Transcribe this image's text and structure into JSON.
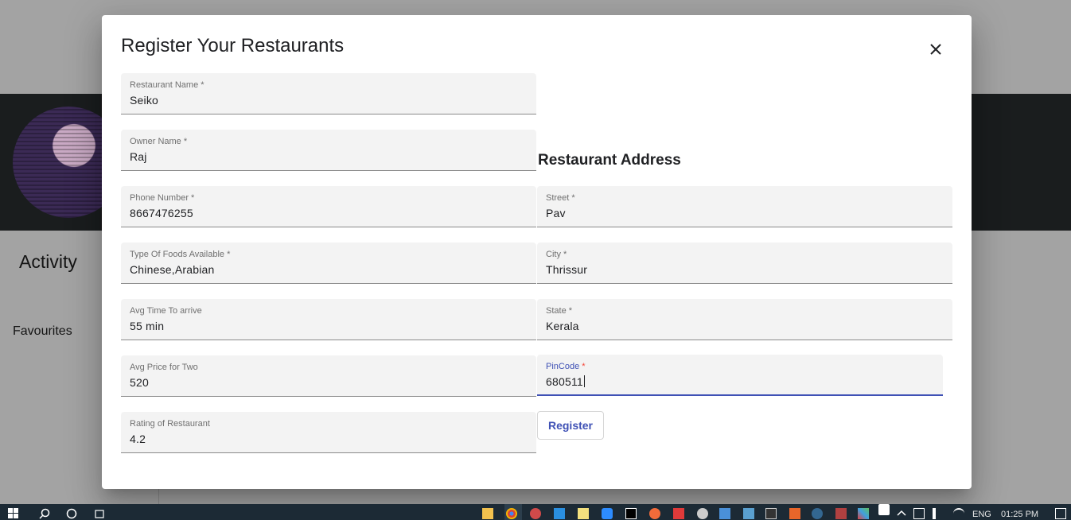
{
  "background": {
    "activity_heading": "Activity",
    "favourites_label": "Favourites"
  },
  "dialog": {
    "title": "Register Your Restaurants",
    "close_icon": "close-icon",
    "fields_left": [
      {
        "label": "Restaurant Name *",
        "value": "Seiko"
      },
      {
        "label": "Owner Name *",
        "value": "Raj"
      },
      {
        "label": "Phone Number *",
        "value": "8667476255"
      },
      {
        "label": "Type Of Foods Available *",
        "value": "Chinese,Arabian"
      },
      {
        "label": "Avg Time To arrive",
        "value": "55 min"
      },
      {
        "label": "Avg Price for Two",
        "value": "520"
      },
      {
        "label": "Rating of Restaurant",
        "value": "4.2"
      }
    ],
    "address_title": "Restaurant Address",
    "fields_right": [
      {
        "label": "Street *",
        "value": "Pav"
      },
      {
        "label": "City *",
        "value": "Thrissur"
      },
      {
        "label": "State *",
        "value": "Kerala"
      },
      {
        "label": "PinCode",
        "required_mark": "*",
        "value": "680511"
      }
    ],
    "register_label": "Register"
  },
  "colors": {
    "accent": "#3f51b5",
    "required": "#f44336",
    "field_bg": "#f3f3f3",
    "banner": "#1a1d1e",
    "taskbar": "#1c2a35"
  },
  "taskbar": {
    "language": "ENG",
    "time": "01:25 PM"
  }
}
